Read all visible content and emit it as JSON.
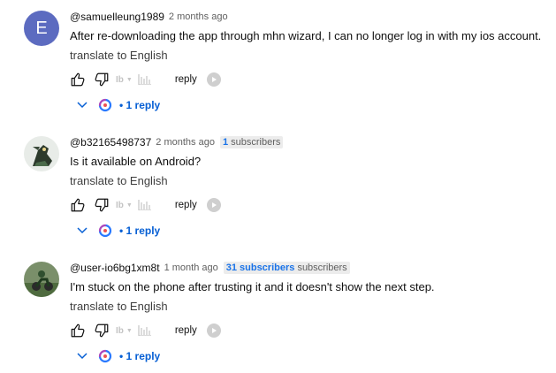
{
  "comments": [
    {
      "avatar_letter": "E",
      "author": "@samuelleung1989",
      "time": "2 months ago",
      "subscribers_num": "",
      "subscribers_label": "",
      "text": "After re-downloading the app through mhn wizard, I can no longer log in with my ios account.",
      "translate": "translate to English",
      "reply_label": "reply",
      "dislike_text": "Ib",
      "replies_label": "• 1 reply"
    },
    {
      "avatar_letter": "",
      "author": "@b32165498737",
      "time": "2 months ago",
      "subscribers_num": "1",
      "subscribers_label": "subscribers",
      "text": "Is it available on Android?",
      "translate": "translate to English",
      "reply_label": "reply",
      "dislike_text": "Ib",
      "replies_label": "• 1 reply"
    },
    {
      "avatar_letter": "",
      "author": "@user-io6bg1xm8t",
      "time": "1 month ago",
      "subscribers_num": "31 subscribers",
      "subscribers_label": "subscribers",
      "text": "I'm stuck on the phone after trusting it and it doesn't show the next step.",
      "translate": "translate to English",
      "reply_label": "reply",
      "dislike_text": "Ib",
      "replies_label": "• 1 reply"
    }
  ],
  "colors": {
    "avatar_bg": "#5c6bc0",
    "link_blue": "#065fd4",
    "subs_blue": "#1a73e8"
  },
  "icons": [
    "like-icon",
    "dislike-icon",
    "translate-bars-icon",
    "play-icon",
    "chevron-down-icon",
    "ai-swirl-icon"
  ]
}
